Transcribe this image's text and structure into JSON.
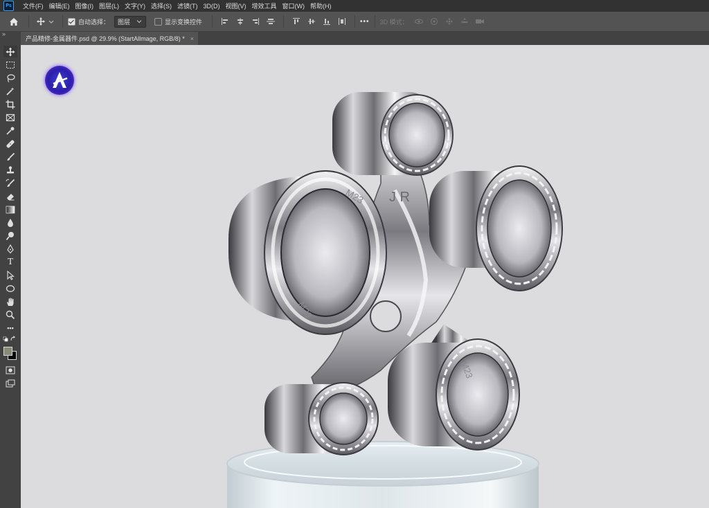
{
  "menubar": {
    "logo": "Ps",
    "items": [
      "文件(F)",
      "编辑(E)",
      "图像(I)",
      "图层(L)",
      "文字(Y)",
      "选择(S)",
      "滤镜(T)",
      "3D(D)",
      "视图(V)",
      "增效工具",
      "窗口(W)",
      "帮助(H)"
    ]
  },
  "options": {
    "auto_select_label": "自动选择：",
    "auto_select_checked": true,
    "target_select": "图层",
    "show_transform_label": "显示变换控件",
    "show_transform_checked": false,
    "more_label": "•••",
    "mode_3d_label": "3D 模式："
  },
  "document": {
    "tab_title": "产品精修-金属器件.psd @ 29.9% (StartAllmage, RGB/8) *",
    "close_glyph": "×",
    "panel_collapse": "»"
  },
  "toolbar": {
    "tools": [
      "move-tool",
      "marquee-tool",
      "lasso-tool",
      "magic-wand-tool",
      "crop-tool",
      "frame-tool",
      "eyedropper-tool",
      "healing-brush-tool",
      "brush-tool",
      "clone-stamp-tool",
      "history-brush-tool",
      "eraser-tool",
      "gradient-tool",
      "blur-tool",
      "dodge-tool",
      "pen-tool",
      "type-tool",
      "path-selection-tool",
      "ellipse-tool",
      "hand-tool",
      "zoom-tool",
      "edit-toolbar"
    ],
    "type_glyph": "T",
    "more_glyph": "•••",
    "foreground_color": "#8a8a78",
    "background_color": "#000000"
  },
  "canvas": {
    "background": "#dcdcdf",
    "watermark_letter": "A",
    "engravings": [
      "M23",
      "J R",
      "M23",
      "M23"
    ]
  }
}
